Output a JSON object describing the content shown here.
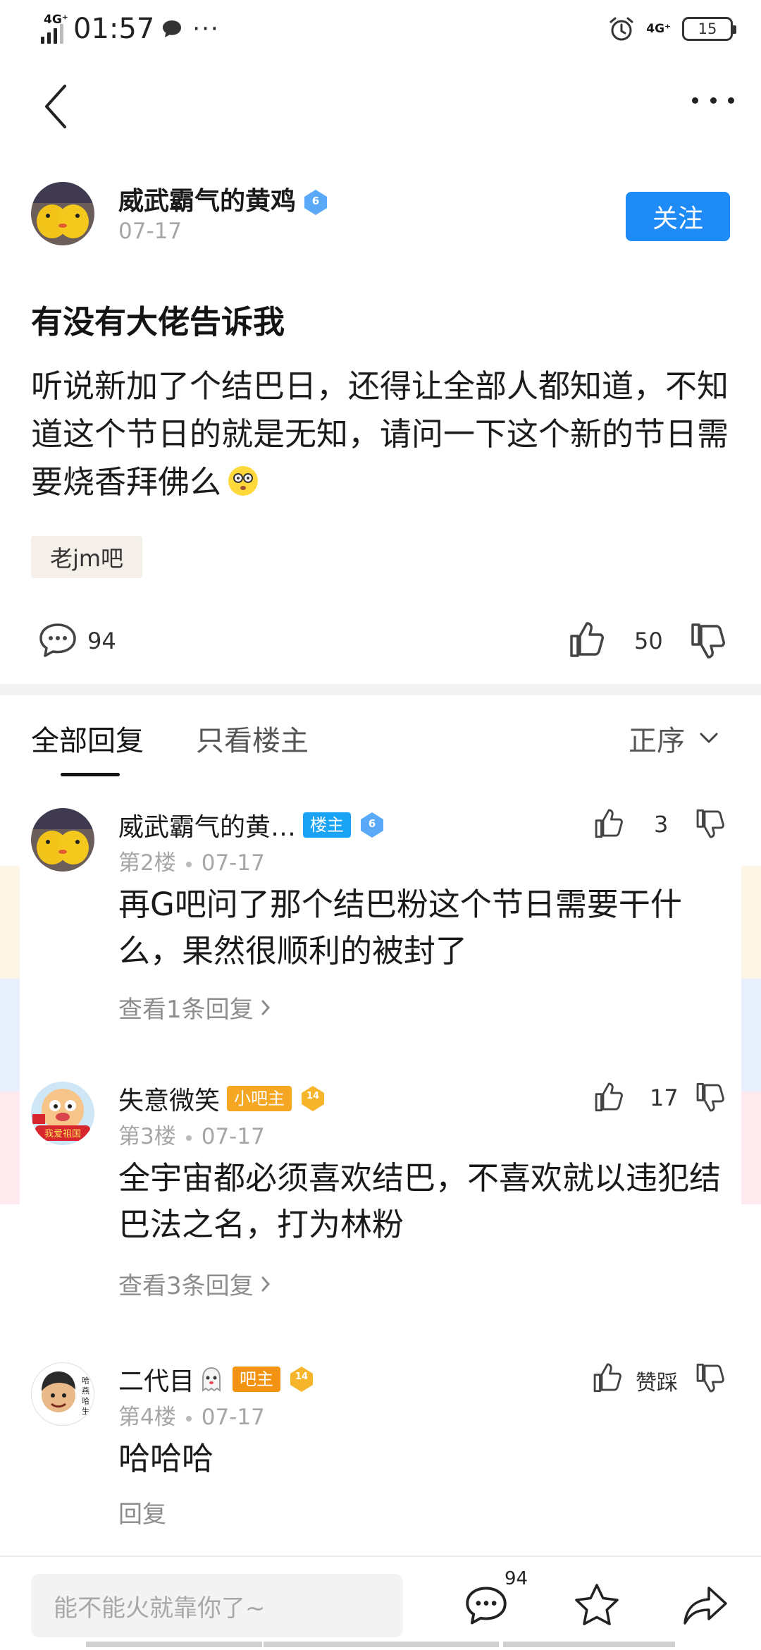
{
  "status_bar": {
    "network_left": "4G⁺",
    "time": "01:57",
    "network_right": "4G⁺",
    "battery": "15"
  },
  "author": {
    "name": "威武霸气的黄鸡",
    "level": "6",
    "date": "07-17",
    "follow_label": "关注"
  },
  "post": {
    "title": "有没有大佬告诉我",
    "body": "听说新加了个结巴日，还得让全部人都知道，不知道这个节日的就是无知，请问一下这个新的节日需要烧香拜佛么",
    "bar_tag": "老jm吧",
    "comment_count": "94",
    "like_count": "50"
  },
  "tabs": {
    "all": "全部回复",
    "op_only": "只看楼主",
    "sort": "正序"
  },
  "replies": [
    {
      "name": "威武霸气的黄…",
      "role": "楼主",
      "level": "6",
      "floor": "第2楼",
      "date": "07-17",
      "text": "再G吧问了那个结巴粉这个节日需要干什么，果然很顺利的被封了",
      "more": "查看1条回复",
      "likes": "3"
    },
    {
      "name": "失意微笑",
      "role": "小吧主",
      "level": "14",
      "floor": "第3楼",
      "date": "07-17",
      "text": "全宇宙都必须喜欢结巴，不喜欢就以违犯结巴法之名，打为林粉",
      "more": "查看3条回复",
      "likes": "17",
      "avatar_text": "我爱祖国"
    },
    {
      "name": "二代目",
      "role": "吧主",
      "level": "14",
      "floor": "第4楼",
      "date": "07-17",
      "text": "哈哈哈",
      "more": "回复",
      "likes": "赞踩",
      "avatar_text": "哈 燕 哈 生"
    }
  ],
  "bottom_bar": {
    "placeholder": "能不能火就靠你了~",
    "comment_count": "94"
  },
  "colors": {
    "accent": "#1f8bf6",
    "op_badge": "#1aa3f5",
    "admin_badge": "#f39312",
    "level_badge": "#5aa9f8"
  }
}
